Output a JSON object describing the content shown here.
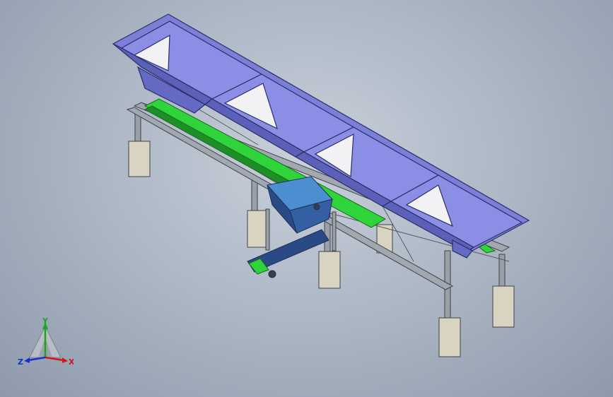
{
  "view": {
    "background_center": "#c9d0da",
    "background_edge": "#8e9aab"
  },
  "colors": {
    "hopper_fill": "#7b7fd8",
    "hopper_dark": "#4f54a8",
    "hopper_light": "#a9acf0",
    "hopper_inner_white": "#f2f2f4",
    "belt_green": "#2fd33a",
    "frame_gray": "#8a8f96",
    "frame_edge": "#3e4248",
    "footing_fill": "#d9d4c2",
    "discharge_conveyor": "#2a4a86",
    "discharge_hopper": "#4c8fd1"
  },
  "triad": {
    "y_label": "Y",
    "x_label": "X",
    "z_label": "Z",
    "y_color": "#1aa51a",
    "x_color": "#d01818",
    "z_color": "#1a2fd0"
  }
}
